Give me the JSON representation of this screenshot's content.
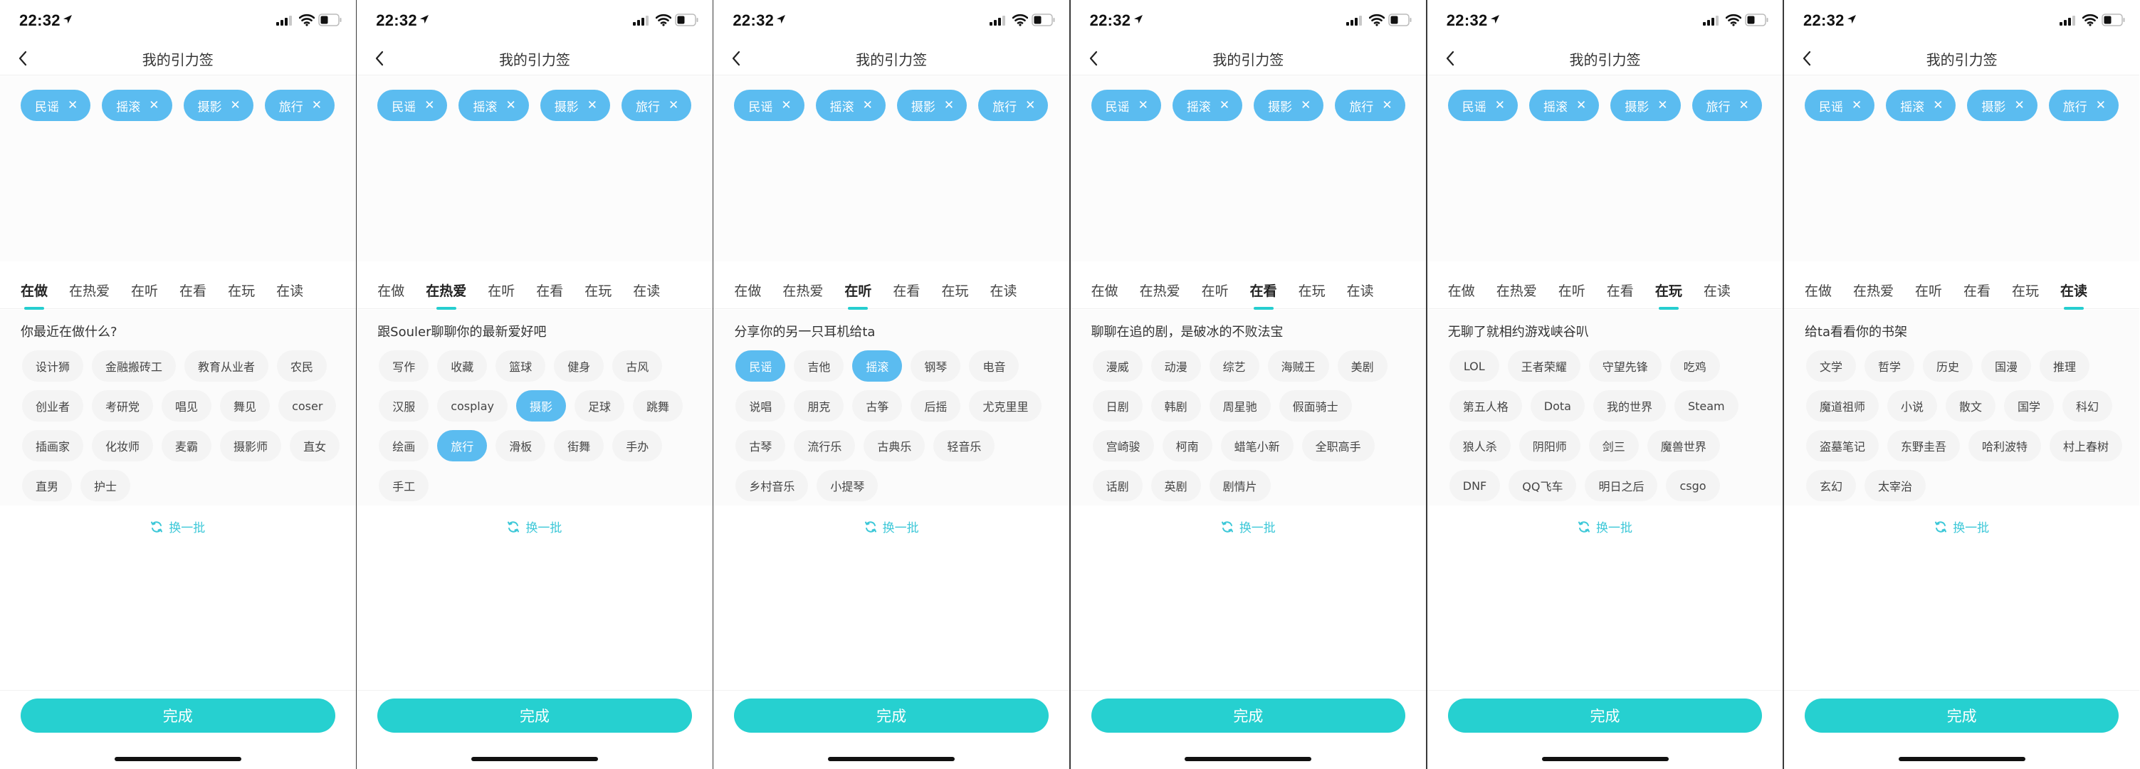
{
  "status_bar": {
    "time": "22:32"
  },
  "nav": {
    "title": "我的引力签"
  },
  "selected_tags": [
    "民谣",
    "摇滚",
    "摄影",
    "旅行"
  ],
  "tabs": [
    "在做",
    "在热爱",
    "在听",
    "在看",
    "在玩",
    "在读"
  ],
  "refresh_label": "换一批",
  "done_label": "完成",
  "colors": {
    "accent": "#26d0d0",
    "selected_chip": "#5bbcf0",
    "chip_bg": "#f4f4f4"
  },
  "screens": [
    {
      "active_tab": 0,
      "prompt": "你最近在做什么?",
      "chips": [
        {
          "label": "设计狮",
          "selected": false
        },
        {
          "label": "金融搬砖工",
          "selected": false
        },
        {
          "label": "教育从业者",
          "selected": false
        },
        {
          "label": "农民",
          "selected": false
        },
        {
          "label": "创业者",
          "selected": false
        },
        {
          "label": "考研党",
          "selected": false
        },
        {
          "label": "唱见",
          "selected": false
        },
        {
          "label": "舞见",
          "selected": false
        },
        {
          "label": "coser",
          "selected": false
        },
        {
          "label": "插画家",
          "selected": false
        },
        {
          "label": "化妆师",
          "selected": false
        },
        {
          "label": "麦霸",
          "selected": false
        },
        {
          "label": "摄影师",
          "selected": false
        },
        {
          "label": "直女",
          "selected": false
        },
        {
          "label": "直男",
          "selected": false
        },
        {
          "label": "护士",
          "selected": false
        }
      ]
    },
    {
      "active_tab": 1,
      "prompt": "跟Souler聊聊你的最新爱好吧",
      "chips": [
        {
          "label": "写作",
          "selected": false
        },
        {
          "label": "收藏",
          "selected": false
        },
        {
          "label": "篮球",
          "selected": false
        },
        {
          "label": "健身",
          "selected": false
        },
        {
          "label": "古风",
          "selected": false
        },
        {
          "label": "汉服",
          "selected": false
        },
        {
          "label": "cosplay",
          "selected": false
        },
        {
          "label": "摄影",
          "selected": true
        },
        {
          "label": "足球",
          "selected": false
        },
        {
          "label": "跳舞",
          "selected": false
        },
        {
          "label": "绘画",
          "selected": false
        },
        {
          "label": "旅行",
          "selected": true
        },
        {
          "label": "滑板",
          "selected": false
        },
        {
          "label": "街舞",
          "selected": false
        },
        {
          "label": "手办",
          "selected": false
        },
        {
          "label": "手工",
          "selected": false
        }
      ]
    },
    {
      "active_tab": 2,
      "prompt": "分享你的另一只耳机给ta",
      "chips": [
        {
          "label": "民谣",
          "selected": true
        },
        {
          "label": "吉他",
          "selected": false
        },
        {
          "label": "摇滚",
          "selected": true
        },
        {
          "label": "钢琴",
          "selected": false
        },
        {
          "label": "电音",
          "selected": false
        },
        {
          "label": "说唱",
          "selected": false
        },
        {
          "label": "朋克",
          "selected": false
        },
        {
          "label": "古筝",
          "selected": false
        },
        {
          "label": "后摇",
          "selected": false
        },
        {
          "label": "尤克里里",
          "selected": false
        },
        {
          "label": "古琴",
          "selected": false
        },
        {
          "label": "流行乐",
          "selected": false
        },
        {
          "label": "古典乐",
          "selected": false
        },
        {
          "label": "轻音乐",
          "selected": false
        },
        {
          "label": "乡村音乐",
          "selected": false
        },
        {
          "label": "小提琴",
          "selected": false
        }
      ]
    },
    {
      "active_tab": 3,
      "prompt": "聊聊在追的剧，是破冰的不败法宝",
      "chips": [
        {
          "label": "漫威",
          "selected": false
        },
        {
          "label": "动漫",
          "selected": false
        },
        {
          "label": "综艺",
          "selected": false
        },
        {
          "label": "海贼王",
          "selected": false
        },
        {
          "label": "美剧",
          "selected": false
        },
        {
          "label": "日剧",
          "selected": false
        },
        {
          "label": "韩剧",
          "selected": false
        },
        {
          "label": "周星驰",
          "selected": false
        },
        {
          "label": "假面骑士",
          "selected": false
        },
        {
          "label": "宫崎骏",
          "selected": false
        },
        {
          "label": "柯南",
          "selected": false
        },
        {
          "label": "蜡笔小新",
          "selected": false
        },
        {
          "label": "全职高手",
          "selected": false
        },
        {
          "label": "话剧",
          "selected": false
        },
        {
          "label": "英剧",
          "selected": false
        },
        {
          "label": "剧情片",
          "selected": false
        }
      ]
    },
    {
      "active_tab": 4,
      "prompt": "无聊了就相约游戏峡谷叭",
      "chips": [
        {
          "label": "LOL",
          "selected": false
        },
        {
          "label": "王者荣耀",
          "selected": false
        },
        {
          "label": "守望先锋",
          "selected": false
        },
        {
          "label": "吃鸡",
          "selected": false
        },
        {
          "label": "第五人格",
          "selected": false
        },
        {
          "label": "Dota",
          "selected": false
        },
        {
          "label": "我的世界",
          "selected": false
        },
        {
          "label": "Steam",
          "selected": false
        },
        {
          "label": "狼人杀",
          "selected": false
        },
        {
          "label": "阴阳师",
          "selected": false
        },
        {
          "label": "剑三",
          "selected": false
        },
        {
          "label": "魔兽世界",
          "selected": false
        },
        {
          "label": "DNF",
          "selected": false
        },
        {
          "label": "QQ飞车",
          "selected": false
        },
        {
          "label": "明日之后",
          "selected": false
        },
        {
          "label": "csgo",
          "selected": false
        }
      ]
    },
    {
      "active_tab": 5,
      "prompt": "给ta看看你的书架",
      "chips": [
        {
          "label": "文学",
          "selected": false
        },
        {
          "label": "哲学",
          "selected": false
        },
        {
          "label": "历史",
          "selected": false
        },
        {
          "label": "国漫",
          "selected": false
        },
        {
          "label": "推理",
          "selected": false
        },
        {
          "label": "魔道祖师",
          "selected": false
        },
        {
          "label": "小说",
          "selected": false
        },
        {
          "label": "散文",
          "selected": false
        },
        {
          "label": "国学",
          "selected": false
        },
        {
          "label": "科幻",
          "selected": false
        },
        {
          "label": "盗墓笔记",
          "selected": false
        },
        {
          "label": "东野圭吾",
          "selected": false
        },
        {
          "label": "哈利波特",
          "selected": false
        },
        {
          "label": "村上春树",
          "selected": false
        },
        {
          "label": "玄幻",
          "selected": false
        },
        {
          "label": "太宰治",
          "selected": false
        }
      ]
    }
  ]
}
